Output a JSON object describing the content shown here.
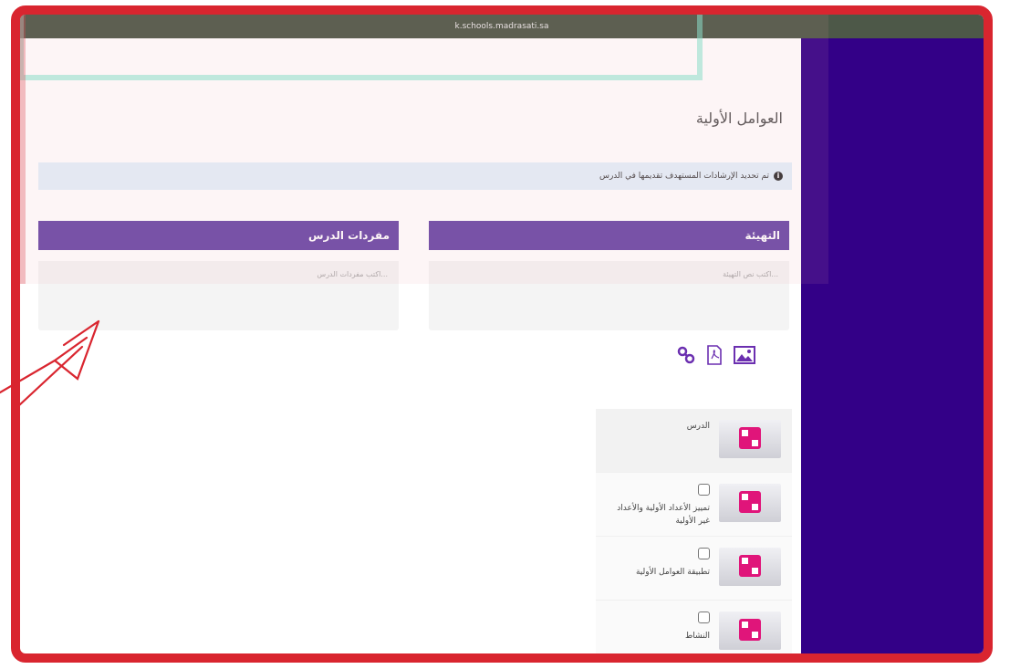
{
  "browser": {
    "url": "k.schools.madrasati.sa"
  },
  "page": {
    "title": "العوامل الأولية"
  },
  "notice": {
    "text": "تم تحديد الإرشادات المستهدف تقديمها في الدرس"
  },
  "cards": {
    "intro": {
      "title": "التهيئة",
      "placeholder": "اكتب نص التهيئة..."
    },
    "vocab": {
      "title": "مفردات الدرس",
      "placeholder": "اكتب مفردات الدرس..."
    }
  },
  "attach": {
    "icons": [
      "link-icon",
      "pdf-icon",
      "image-icon"
    ]
  },
  "items": [
    {
      "label": "الدرس",
      "checkbox": false
    },
    {
      "label": "تمييز الأعداد الأولية والأعداد غير الأولية",
      "checkbox": true
    },
    {
      "label": "تطبيقة العوامل الأولية",
      "checkbox": true
    },
    {
      "label": "النشاط",
      "checkbox": true
    }
  ],
  "colors": {
    "frame": "#d9252f",
    "panel": "#330087",
    "header": "#6b4aa8"
  }
}
